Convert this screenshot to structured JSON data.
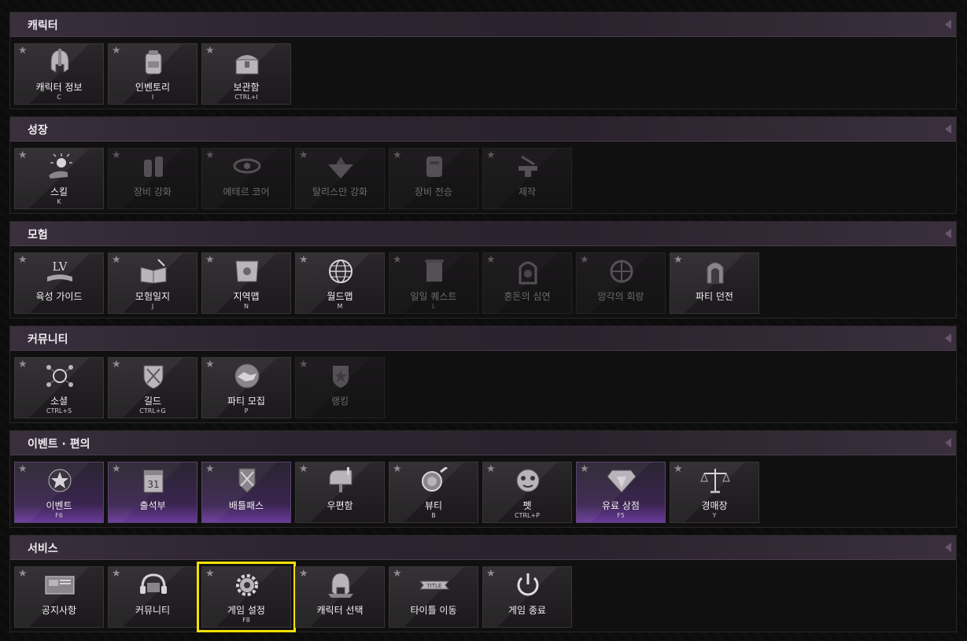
{
  "sections": [
    {
      "title": "캐릭터",
      "items": [
        {
          "label": "캐릭터 정보",
          "key": "C",
          "icon": "helmet-icon"
        },
        {
          "label": "인벤토리",
          "key": "I",
          "icon": "backpack-icon"
        },
        {
          "label": "보관함",
          "key": "CTRL+I",
          "icon": "chest-icon"
        }
      ]
    },
    {
      "title": "성장",
      "items": [
        {
          "label": "스킬",
          "key": "K",
          "icon": "skill-orb-icon"
        },
        {
          "label": "장비 강화",
          "key": "",
          "icon": "armor-enhance-icon"
        },
        {
          "label": "에테르 코어",
          "key": "",
          "icon": "ether-core-icon"
        },
        {
          "label": "탈리스만 강화",
          "key": "",
          "icon": "talisman-icon"
        },
        {
          "label": "장비 전승",
          "key": "",
          "icon": "equipment-inherit-icon"
        },
        {
          "label": "제작",
          "key": "",
          "icon": "anvil-icon"
        }
      ]
    },
    {
      "title": "모험",
      "items": [
        {
          "label": "육성 가이드",
          "key": "",
          "icon": "lv-book-icon"
        },
        {
          "label": "모험일지",
          "key": "J",
          "icon": "journal-icon"
        },
        {
          "label": "지역맵",
          "key": "N",
          "icon": "region-map-icon"
        },
        {
          "label": "월드맵",
          "key": "M",
          "icon": "globe-icon"
        },
        {
          "label": "일일 퀘스트",
          "key": "L",
          "icon": "scroll-icon"
        },
        {
          "label": "혼돈의 심연",
          "key": "",
          "icon": "chaos-abyss-icon"
        },
        {
          "label": "망각의 회랑",
          "key": "",
          "icon": "oblivion-corridor-icon"
        },
        {
          "label": "파티 던전",
          "key": "",
          "icon": "party-dungeon-icon"
        }
      ]
    },
    {
      "title": "커뮤니티",
      "items": [
        {
          "label": "소셜",
          "key": "CTRL+S",
          "icon": "social-network-icon"
        },
        {
          "label": "길드",
          "key": "CTRL+G",
          "icon": "guild-shield-icon"
        },
        {
          "label": "파티 모집",
          "key": "P",
          "icon": "handshake-icon"
        },
        {
          "label": "랭킹",
          "key": "",
          "icon": "ranking-badge-icon"
        }
      ]
    },
    {
      "title": "이벤트 · 편의",
      "items": [
        {
          "label": "이벤트",
          "key": "F6",
          "icon": "event-star-icon"
        },
        {
          "label": "출석부",
          "key": "",
          "icon": "calendar-icon",
          "calendar_day": "31"
        },
        {
          "label": "배틀패스",
          "key": "",
          "icon": "battle-pass-icon"
        },
        {
          "label": "우편함",
          "key": "",
          "icon": "mailbox-icon"
        },
        {
          "label": "뷰티",
          "key": "B",
          "icon": "beauty-mirror-icon"
        },
        {
          "label": "펫",
          "key": "CTRL+P",
          "icon": "pet-icon"
        },
        {
          "label": "유료 상점",
          "key": "F5",
          "icon": "diamond-shop-icon"
        },
        {
          "label": "경매장",
          "key": "Y",
          "icon": "scales-icon"
        }
      ]
    },
    {
      "title": "서비스",
      "items": [
        {
          "label": "공지사항",
          "key": "",
          "icon": "notice-board-icon"
        },
        {
          "label": "커뮤니티",
          "key": "",
          "icon": "headset-icon"
        },
        {
          "label": "게임 설정",
          "key": "F8",
          "icon": "gear-icon"
        },
        {
          "label": "캐릭터 선택",
          "key": "",
          "icon": "character-select-icon"
        },
        {
          "label": "타이틀 이동",
          "key": "",
          "icon": "title-banner-icon",
          "banner_text": "TITLE"
        },
        {
          "label": "게임 종료",
          "key": "",
          "icon": "power-icon"
        }
      ]
    }
  ],
  "star_glyph": "★",
  "colors": {
    "selected_outline": "#f2e200",
    "header_purple": "#3a2f3c",
    "event_glow": "#6a3a9a"
  }
}
